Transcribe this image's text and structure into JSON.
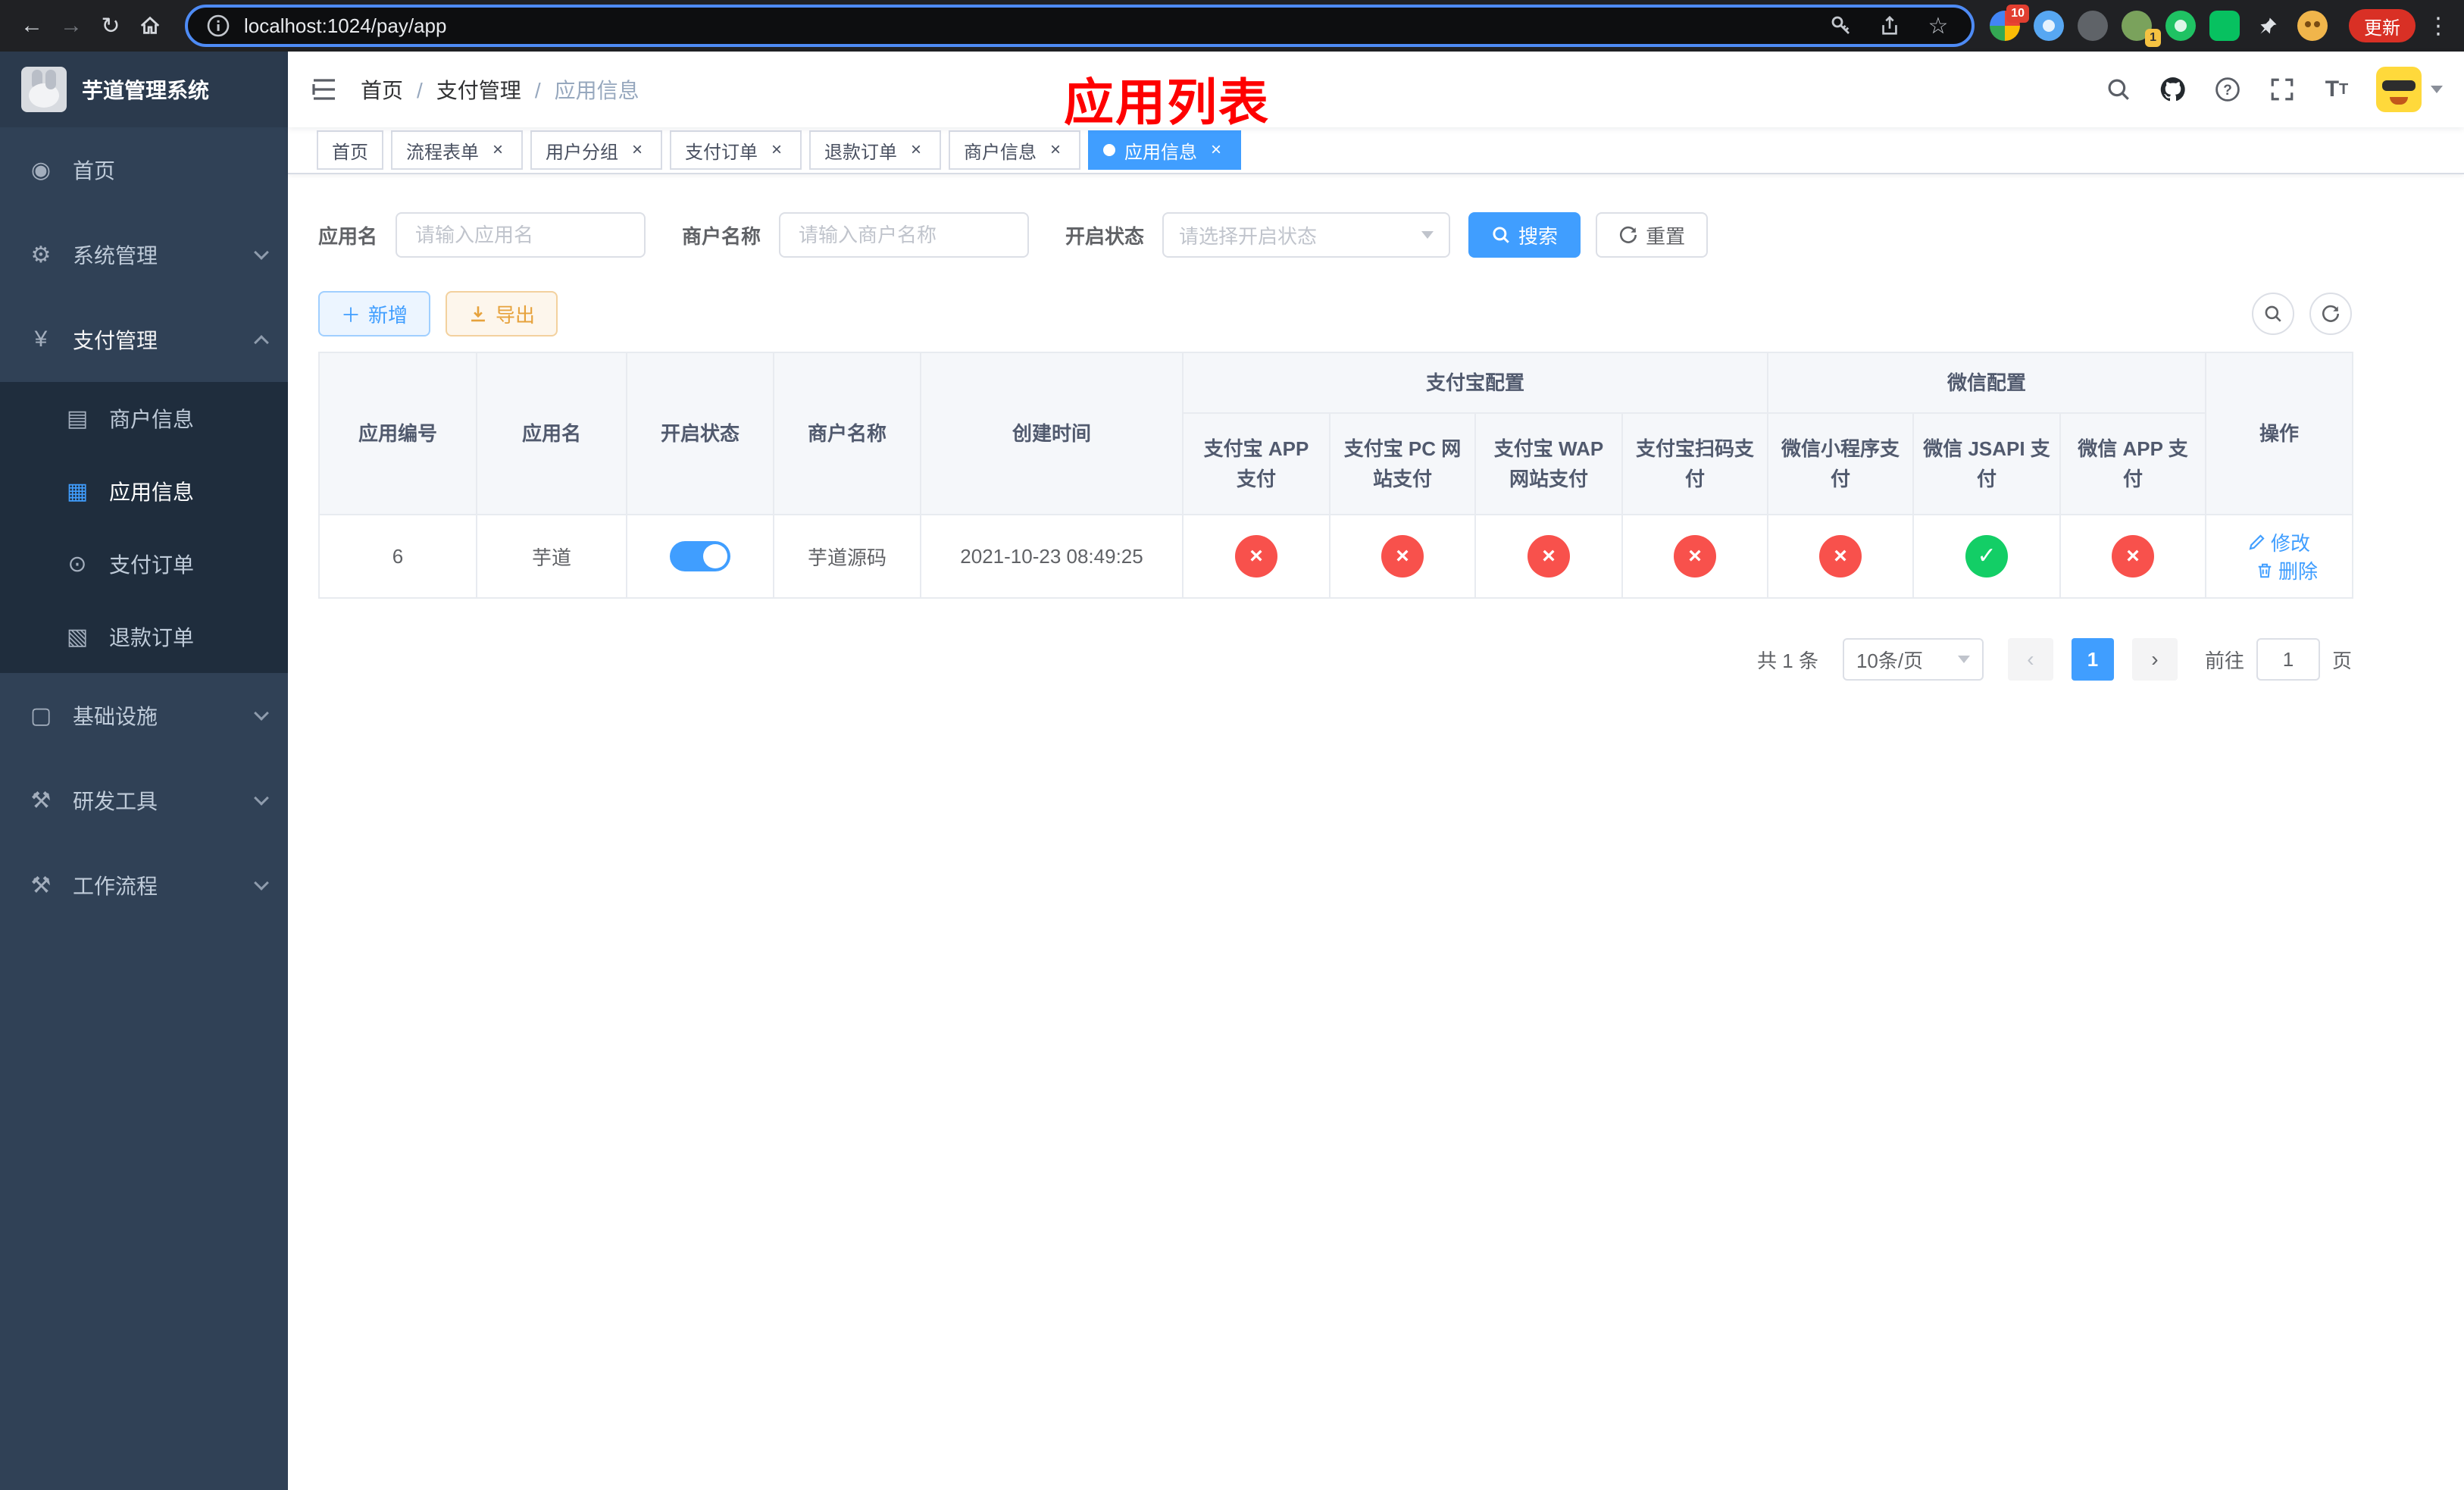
{
  "colors": {
    "primary": "#409eff",
    "danger_circle": "#f8514c",
    "success_circle": "#13ce66",
    "overlay_title_red": "#fe0000",
    "sidebar_bg": "#304156",
    "submenu_bg": "#1f2d3d",
    "tab_active": "#409eff"
  },
  "browser": {
    "url": "localhost:1024/pay/app",
    "update_label": "更新",
    "ext_badge_first": "10",
    "ext_badge_fourth": "1"
  },
  "sidebar": {
    "title": "芋道管理系统",
    "items": [
      {
        "label": "首页",
        "icon": "◉"
      },
      {
        "label": "系统管理",
        "icon": "⚙"
      },
      {
        "label": "支付管理",
        "icon": "¥"
      },
      {
        "label": "商户信息",
        "icon": "▤"
      },
      {
        "label": "应用信息",
        "icon": "▦"
      },
      {
        "label": "支付订单",
        "icon": "⊙"
      },
      {
        "label": "退款订单",
        "icon": "▧"
      },
      {
        "label": "基础设施",
        "icon": "▢"
      },
      {
        "label": "研发工具",
        "icon": "⚒"
      },
      {
        "label": "工作流程",
        "icon": "⚒"
      }
    ]
  },
  "header": {
    "breadcrumb": [
      "首页",
      "支付管理",
      "应用信息"
    ],
    "overlay_title": "应用列表"
  },
  "tabs": [
    {
      "label": "首页"
    },
    {
      "label": "流程表单"
    },
    {
      "label": "用户分组"
    },
    {
      "label": "支付订单"
    },
    {
      "label": "退款订单"
    },
    {
      "label": "商户信息"
    },
    {
      "label": "应用信息"
    }
  ],
  "filters": {
    "app_name_label": "应用名",
    "app_name_placeholder": "请输入应用名",
    "merchant_label": "商户名称",
    "merchant_placeholder": "请输入商户名称",
    "status_label": "开启状态",
    "status_placeholder": "请选择开启状态",
    "search_label": "搜索",
    "reset_label": "重置"
  },
  "toolbar": {
    "add_label": "新增",
    "export_label": "导出"
  },
  "table": {
    "group_alipay": "支付宝配置",
    "group_wechat": "微信配置",
    "col_app_id": "应用编号",
    "col_app_name": "应用名",
    "col_status": "开启状态",
    "col_merchant": "商户名称",
    "col_created": "创建时间",
    "col_alipay_app": "支付宝 APP 支付",
    "col_alipay_pc": "支付宝 PC 网站支付",
    "col_alipay_wap": "支付宝 WAP 网站支付",
    "col_alipay_qr": "支付宝扫码支付",
    "col_wx_mini": "微信小程序支付",
    "col_wx_jsapi": "微信 JSAPI 支付",
    "col_wx_app": "微信 APP 支付",
    "col_actions": "操作",
    "rows": [
      {
        "id": "6",
        "name": "芋道",
        "enabled": true,
        "merchant": "芋道源码",
        "created": "2021-10-23 08:49:25",
        "alipay_app": false,
        "alipay_pc": false,
        "alipay_wap": false,
        "alipay_qr": false,
        "wx_mini": false,
        "wx_jsapi": true,
        "wx_app": false,
        "edit_label": "修改",
        "delete_label": "删除"
      }
    ]
  },
  "pagination": {
    "total": "共 1 条",
    "page_size": "10条/页",
    "page": "1",
    "goto": "前往",
    "goto_value": "1",
    "unit": "页"
  }
}
